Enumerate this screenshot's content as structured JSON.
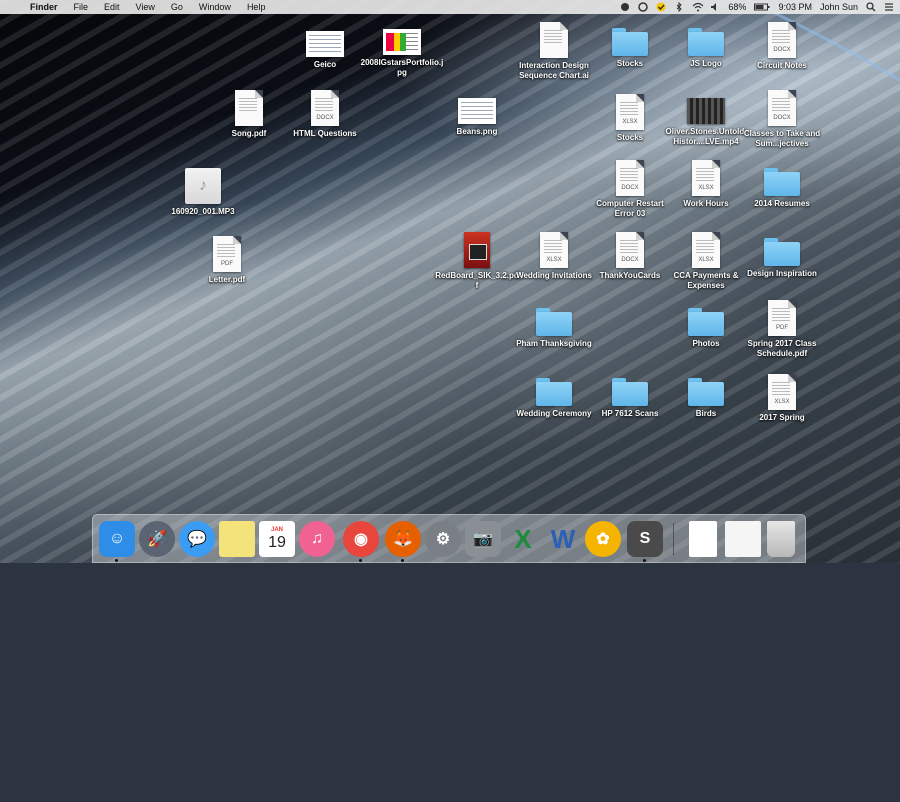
{
  "menubar": {
    "app": "Finder",
    "items": [
      "File",
      "Edit",
      "View",
      "Go",
      "Window",
      "Help"
    ],
    "battery": "68%",
    "time": "9:03 PM",
    "user": "John Sun"
  },
  "desktop": {
    "icons": [
      {
        "label": "Geico",
        "kind": "image"
      },
      {
        "label": "2008IGstarsPortfolio.jpg",
        "kind": "image-chart"
      },
      {
        "label": "Interaction Design Sequence Chart.ai",
        "kind": "doc",
        "ext": ""
      },
      {
        "label": "Stocks",
        "kind": "folder"
      },
      {
        "label": "JS Logo",
        "kind": "folder"
      },
      {
        "label": "Circuit Notes",
        "kind": "doc",
        "ext": "DOCX"
      },
      {
        "label": "Song.pdf",
        "kind": "doc",
        "ext": ""
      },
      {
        "label": "HTML Questions",
        "kind": "doc",
        "ext": "DOCX"
      },
      {
        "label": "Beans.png",
        "kind": "image"
      },
      {
        "label": "Stocks",
        "kind": "doc",
        "ext": "XLSX"
      },
      {
        "label": "Oliver.Stones.Untold.Histor....LVE.mp4",
        "kind": "video"
      },
      {
        "label": "Classes to Take and Sum...jectives",
        "kind": "doc",
        "ext": "DOCX"
      },
      {
        "label": "160920_001.MP3",
        "kind": "mp3"
      },
      {
        "label": "Computer Restart Error 03",
        "kind": "doc",
        "ext": "DOCX"
      },
      {
        "label": "Work Hours",
        "kind": "doc",
        "ext": "XLSX"
      },
      {
        "label": "2014 Resumes",
        "kind": "folder"
      },
      {
        "label": "Letter.pdf",
        "kind": "doc",
        "ext": "PDF"
      },
      {
        "label": "RedBoard_SIK_3.2.pdf",
        "kind": "redbook"
      },
      {
        "label": "Wedding Invitations",
        "kind": "doc",
        "ext": "XLSX"
      },
      {
        "label": "ThankYouCards",
        "kind": "doc",
        "ext": "DOCX"
      },
      {
        "label": "CCA Payments & Expenses",
        "kind": "doc",
        "ext": "XLSX"
      },
      {
        "label": "Design Inspiration",
        "kind": "folder"
      },
      {
        "label": "Pham Thanksgiving",
        "kind": "folder"
      },
      {
        "label": "Photos",
        "kind": "folder"
      },
      {
        "label": "Spring 2017 Class Schedule.pdf",
        "kind": "doc",
        "ext": "PDF"
      },
      {
        "label": "Wedding Ceremony",
        "kind": "folder"
      },
      {
        "label": "HP 7612 Scans",
        "kind": "folder"
      },
      {
        "label": "Birds",
        "kind": "folder"
      },
      {
        "label": "2017 Spring",
        "kind": "doc",
        "ext": "XLSX"
      }
    ]
  },
  "dock": {
    "calendar_month": "JAN",
    "calendar_day": "19",
    "apps": [
      {
        "name": "finder-icon",
        "color": "#2e8de6",
        "glyph": "☺",
        "running": true
      },
      {
        "name": "launchpad-icon",
        "color": "#5a6472",
        "glyph": "🚀",
        "running": false
      },
      {
        "name": "messages-icon",
        "color": "#3a9cf3",
        "glyph": "💬",
        "running": false
      },
      {
        "name": "notes-icon",
        "color": "#f4e27a",
        "glyph": "",
        "running": false
      },
      {
        "name": "calendar-icon",
        "color": "#ffffff",
        "glyph": "",
        "running": false
      },
      {
        "name": "itunes-icon",
        "color": "#f06292",
        "glyph": "♫",
        "running": false
      },
      {
        "name": "chrome-icon",
        "color": "#e8453c",
        "glyph": "◉",
        "running": true
      },
      {
        "name": "firefox-icon",
        "color": "#e66000",
        "glyph": "🦊",
        "running": true
      },
      {
        "name": "system-preferences-icon",
        "color": "#7a7f86",
        "glyph": "⚙",
        "running": false
      },
      {
        "name": "preview-icon",
        "color": "#8a8f95",
        "glyph": "📷",
        "running": false
      },
      {
        "name": "excel-icon",
        "color": "#1d8b3c",
        "glyph": "X",
        "running": false
      },
      {
        "name": "word-icon",
        "color": "#2b5fb8",
        "glyph": "W",
        "running": false
      },
      {
        "name": "photos-icon",
        "color": "#f4b400",
        "glyph": "✿",
        "running": false
      },
      {
        "name": "sublime-text-icon",
        "color": "#4a4a4a",
        "glyph": "S",
        "running": true
      }
    ]
  }
}
